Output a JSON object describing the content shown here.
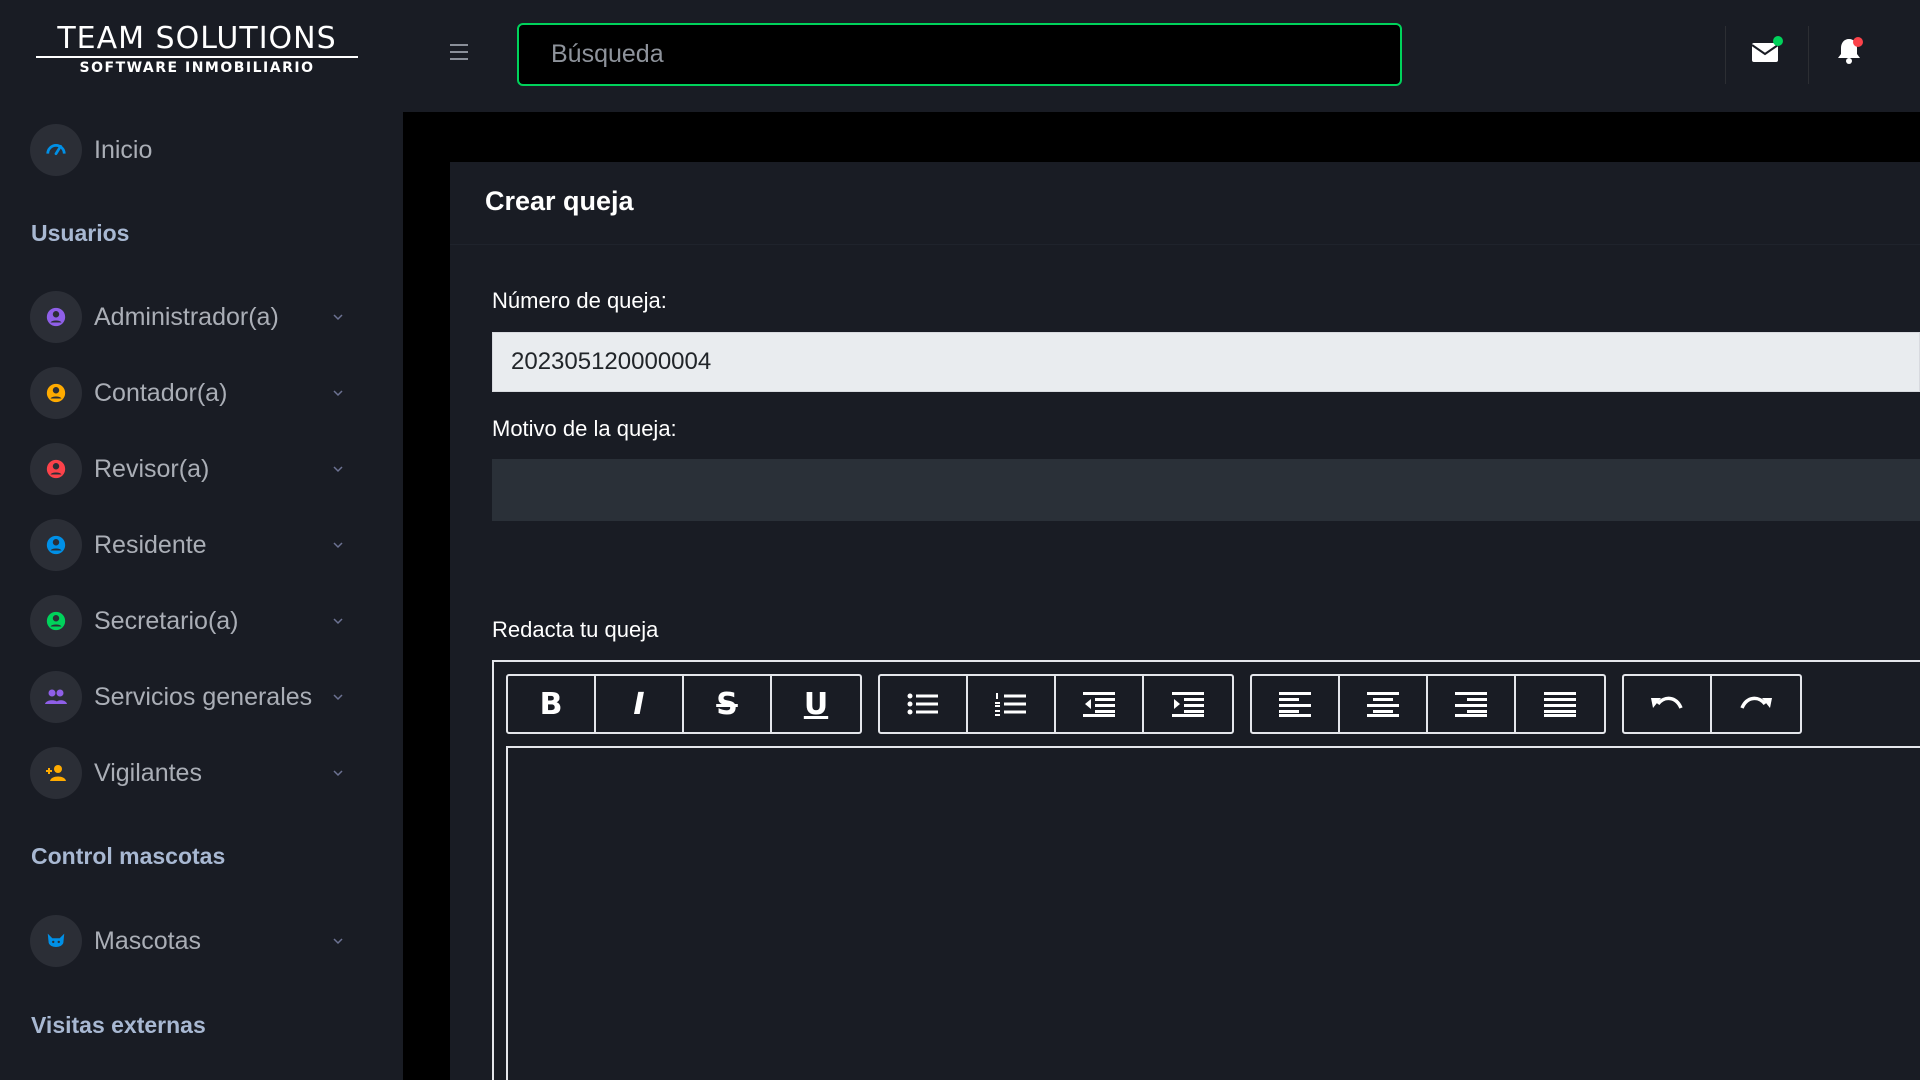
{
  "logo": {
    "line1": "TEAM SOLUTIONS",
    "line2": "SOFTWARE INMOBILIARIO"
  },
  "search": {
    "placeholder": "Búsqueda"
  },
  "sidebar": {
    "home_label": "Inicio",
    "section_usuarios": "Usuarios",
    "usuarios": [
      {
        "label": "Administrador(a)",
        "icon": "user-circle-icon",
        "color": "#8f5fe8"
      },
      {
        "label": "Contador(a)",
        "icon": "user-circle-icon",
        "color": "#ffab00"
      },
      {
        "label": "Revisor(a)",
        "icon": "user-circle-icon",
        "color": "#fc424a"
      },
      {
        "label": "Residente",
        "icon": "user-circle-icon",
        "color": "#0090e7"
      },
      {
        "label": "Secretario(a)",
        "icon": "user-circle-icon",
        "color": "#00d25b"
      },
      {
        "label": "Servicios generales",
        "icon": "users-icon",
        "color": "#8f5fe8"
      },
      {
        "label": "Vigilantes",
        "icon": "user-plus-icon",
        "color": "#ffab00"
      }
    ],
    "section_mascotas": "Control mascotas",
    "mascotas": [
      {
        "label": "Mascotas",
        "icon": "paw-icon",
        "color": "#0090e7"
      }
    ],
    "section_visitas": "Visitas externas"
  },
  "top_icons": [
    {
      "icon": "mail-icon",
      "badge_color": "#00d25b"
    },
    {
      "icon": "bell-icon",
      "badge_color": "#fc424a"
    }
  ],
  "card": {
    "title": "Crear queja",
    "numero_label": "Número de queja:",
    "numero_value": "202305120000004",
    "motivo_label": "Motivo de la queja:",
    "motivo_value": "",
    "redacta_label": "Redacta tu queja"
  },
  "toolbar": [
    [
      "bold",
      "italic",
      "strikethrough",
      "underline"
    ],
    [
      "bullet-list",
      "numbered-list",
      "outdent",
      "indent"
    ],
    [
      "align-left",
      "align-center",
      "align-right",
      "justify"
    ],
    [
      "undo",
      "redo"
    ]
  ],
  "colors": {
    "accent": "#00d25b",
    "sidebar_bg": "#191c24",
    "content_bg": "#000000"
  }
}
